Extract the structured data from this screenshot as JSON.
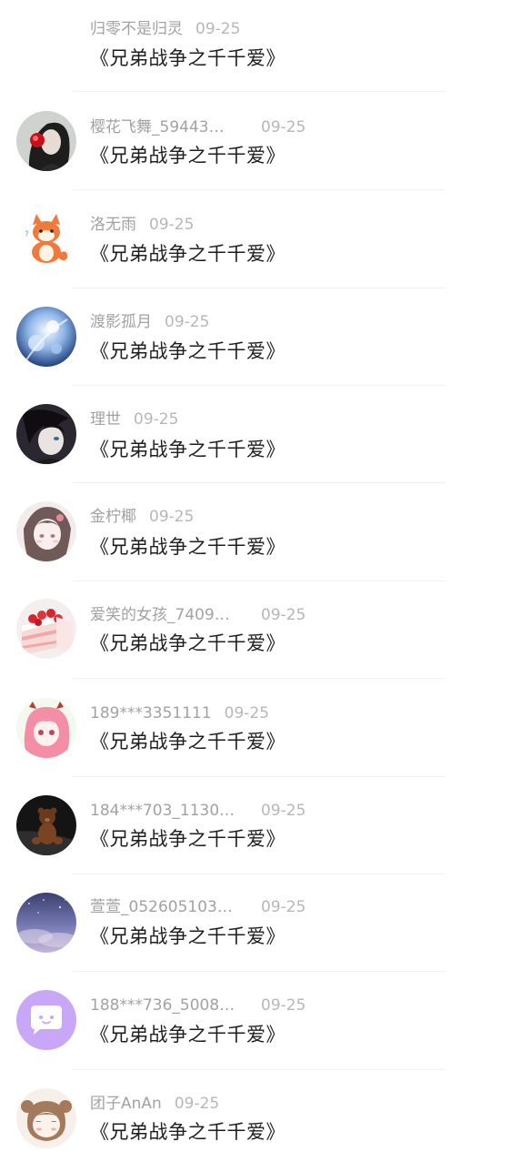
{
  "comments": [
    {
      "user": "归零不是归灵",
      "date": "09-25",
      "text": "《兄弟战争之千千爱》",
      "avatar": "none"
    },
    {
      "user": "樱花飞舞_59443…",
      "date": "09-25",
      "text": "《兄弟战争之千千爱》",
      "avatar": "woman-headphones-icon"
    },
    {
      "user": "洛无雨",
      "date": "09-25",
      "text": "《兄弟战争之千千爱》",
      "avatar": "fox-cartoon-icon"
    },
    {
      "user": "渡影孤月",
      "date": "09-25",
      "text": "《兄弟战争之千千爱》",
      "avatar": "blue-flower-icon"
    },
    {
      "user": "理世",
      "date": "09-25",
      "text": "《兄弟战争之千千爱》",
      "avatar": "anime-boy-icon"
    },
    {
      "user": "金柠椰",
      "date": "09-25",
      "text": "《兄弟战争之千千爱》",
      "avatar": "anime-girl-icon"
    },
    {
      "user": "爱笑的女孩_7409…",
      "date": "09-25",
      "text": "《兄弟战争之千千爱》",
      "avatar": "strawberry-cake-icon"
    },
    {
      "user": "189***3351111",
      "date": "09-25",
      "text": "《兄弟战争之千千爱》",
      "avatar": "pink-hair-girl-icon"
    },
    {
      "user": "184***703_1130…",
      "date": "09-25",
      "text": "《兄弟战争之千千爱》",
      "avatar": "teddy-bear-icon"
    },
    {
      "user": "萱萱_052605103…",
      "date": "09-25",
      "text": "《兄弟战争之千千爱》",
      "avatar": "night-sky-icon"
    },
    {
      "user": "188***736_5008…",
      "date": "09-25",
      "text": "《兄弟战争之千千爱》",
      "avatar": "default-chat-bubble-icon"
    },
    {
      "user": "团子AnAn",
      "date": "09-25",
      "text": "《兄弟战争之千千爱》",
      "avatar": "chibi-girl-icon"
    }
  ],
  "colors": {
    "username": "#a2a2a2",
    "date": "#b7b7b7",
    "message": "#1e1e1e",
    "default_avatar": "#c8a8f6"
  }
}
